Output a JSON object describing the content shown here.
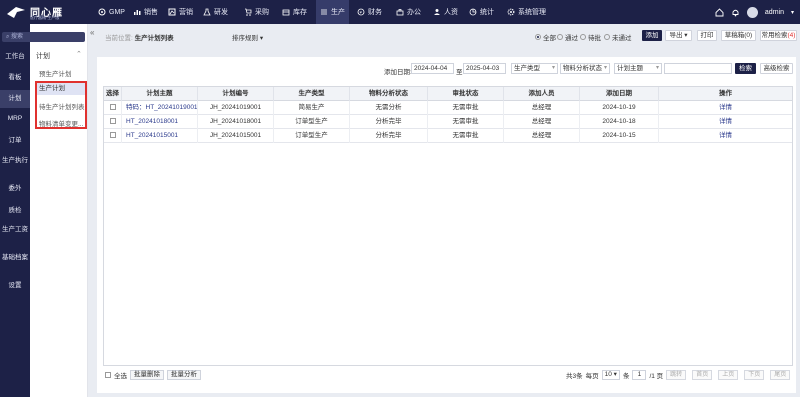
{
  "app": {
    "name": "同心雁",
    "tagline": "医疗器械·生产版"
  },
  "topnav": [
    {
      "label": "GMP",
      "icon": "gear-icon"
    },
    {
      "label": "销售",
      "icon": "bar-chart-icon"
    },
    {
      "label": "营销",
      "icon": "chart-icon"
    },
    {
      "label": "研发",
      "icon": "flask-icon"
    },
    {
      "label": "采购",
      "icon": "cart-icon"
    },
    {
      "label": "库存",
      "icon": "box-icon"
    },
    {
      "label": "生产",
      "icon": "sliders-icon",
      "active": true
    },
    {
      "label": "财务",
      "icon": "coin-icon"
    },
    {
      "label": "办公",
      "icon": "briefcase-icon"
    },
    {
      "label": "人资",
      "icon": "person-icon"
    },
    {
      "label": "统计",
      "icon": "stats-icon"
    },
    {
      "label": "系统管理",
      "icon": "settings-icon"
    }
  ],
  "user": {
    "name": "admin"
  },
  "search": {
    "placeholder": "搜索"
  },
  "sidebar": [
    {
      "label": "工作台"
    },
    {
      "label": "看板"
    },
    {
      "label": "计划",
      "active": true
    },
    {
      "label": "MRP"
    },
    {
      "label": "订单"
    },
    {
      "label": "生产执行"
    },
    {
      "label": "委外"
    },
    {
      "label": "质检"
    },
    {
      "label": "生产工资"
    },
    {
      "label": "基础档案"
    },
    {
      "label": "设置"
    }
  ],
  "subnav": {
    "title": "计划",
    "items": [
      {
        "label": "预生产计划"
      },
      {
        "label": "生产计划",
        "active": true
      },
      {
        "label": "待生产计划列表"
      },
      {
        "label": "物料清单变更..."
      }
    ]
  },
  "breadcrumb": {
    "prefix": "当前位置:",
    "current": "生产计划列表"
  },
  "sort_label": "排序规则",
  "filters_radio": [
    {
      "label": "全部",
      "checked": true
    },
    {
      "label": "通过"
    },
    {
      "label": "待批"
    },
    {
      "label": "未通过"
    }
  ],
  "toolbar": {
    "add": "添加",
    "export": "导出",
    "print": "打印",
    "draft": "草稿箱(0)",
    "common_search": "常用检索",
    "common_search_count": "(4)"
  },
  "search_bar": {
    "date_label": "添加日期:",
    "date_from": "2024-04-04",
    "date_sep": "至",
    "date_to": "2025-04-03",
    "type_select": "生产类型",
    "material_select": "物料分析状态",
    "subject_select": "计划主题",
    "search_btn": "检索",
    "advanced_btn": "高级检索"
  },
  "table": {
    "columns": [
      "选择",
      "计划主题",
      "计划编号",
      "生产类型",
      "物料分析状态",
      "审批状态",
      "添加人员",
      "添加日期",
      "操作"
    ],
    "rows": [
      {
        "subject": "特码：HT_20241019001",
        "code": "JH_20241019001",
        "type": "简易生产",
        "material": "无需分析",
        "approval": "无需审批",
        "creator": "总经理",
        "date": "2024-10-19",
        "action": "详情"
      },
      {
        "subject": "HT_20241018001",
        "code": "JH_20241018001",
        "type": "订单型生产",
        "material": "分析完毕",
        "approval": "无需审批",
        "creator": "总经理",
        "date": "2024-10-18",
        "action": "详情"
      },
      {
        "subject": "HT_20241015001",
        "code": "JH_20241015001",
        "type": "订单型生产",
        "material": "分析完毕",
        "approval": "无需审批",
        "creator": "总经理",
        "date": "2024-10-15",
        "action": "详情"
      }
    ]
  },
  "footer": {
    "select_all": "全选",
    "batch_delete": "批量删除",
    "batch_analyze": "批量分析"
  },
  "pager": {
    "total": "共3条",
    "per_page_label": "每页",
    "per_page": "10",
    "unit": "条",
    "page": "1",
    "total_pages": "/1 页",
    "jump": "跳转",
    "first": "首页",
    "prev": "上页",
    "next": "下页",
    "last": "尾页"
  },
  "colors": {
    "nav_bg": "#1d2147",
    "highlight_box": "#e0312f",
    "link": "#2b3a8c"
  }
}
